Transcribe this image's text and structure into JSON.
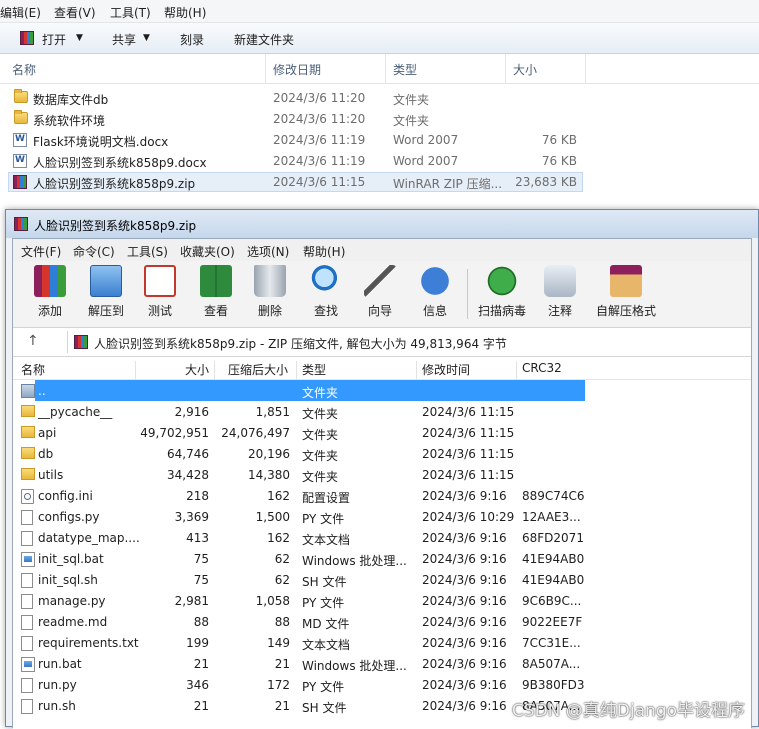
{
  "explorer": {
    "menu": [
      "编辑(E)",
      "查看(V)",
      "工具(T)",
      "帮助(H)"
    ],
    "toolbar": {
      "open": "打开",
      "share": "共享",
      "burn": "刻录",
      "new_folder": "新建文件夹"
    },
    "columns": {
      "name": "名称",
      "date": "修改日期",
      "type": "类型",
      "size": "大小"
    },
    "rows": [
      {
        "name": "数据库文件db",
        "date": "2024/3/6 11:20",
        "type": "文件夹",
        "size": ""
      },
      {
        "name": "系统软件环境",
        "date": "2024/3/6 11:20",
        "type": "文件夹",
        "size": ""
      },
      {
        "name": "Flask环境说明文档.docx",
        "date": "2024/3/6 11:19",
        "type": "Word 2007",
        "size": "76 KB"
      },
      {
        "name": "人脸识别签到系统k858p9.docx",
        "date": "2024/3/6 11:19",
        "type": "Word 2007",
        "size": "76 KB"
      },
      {
        "name": "人脸识别签到系统k858p9.zip",
        "date": "2024/3/6 11:15",
        "type": "WinRAR ZIP 压缩...",
        "size": "23,683 KB"
      }
    ]
  },
  "winrar": {
    "title": "人脸识别签到系统k858p9.zip",
    "menu": [
      "文件(F)",
      "命令(C)",
      "工具(S)",
      "收藏夹(O)",
      "选项(N)",
      "帮助(H)"
    ],
    "tools": [
      "添加",
      "解压到",
      "测试",
      "查看",
      "删除",
      "查找",
      "向导",
      "信息",
      "扫描病毒",
      "注释",
      "自解压格式"
    ],
    "up_arrow": "↑",
    "path": "人脸识别签到系统k858p9.zip - ZIP 压缩文件, 解包大小为 49,813,964 字节",
    "columns": {
      "name": "名称",
      "size": "大小",
      "packed": "压缩后大小",
      "type": "类型",
      "modified": "修改时间",
      "crc": "CRC32"
    },
    "rows": [
      {
        "name": "..",
        "size": "",
        "packed": "",
        "type": "文件夹",
        "modified": "",
        "crc": ""
      },
      {
        "name": "__pycache__",
        "size": "2,916",
        "packed": "1,851",
        "type": "文件夹",
        "modified": "2024/3/6 11:15",
        "crc": ""
      },
      {
        "name": "api",
        "size": "49,702,951",
        "packed": "24,076,497",
        "type": "文件夹",
        "modified": "2024/3/6 11:15",
        "crc": ""
      },
      {
        "name": "db",
        "size": "64,746",
        "packed": "20,196",
        "type": "文件夹",
        "modified": "2024/3/6 11:15",
        "crc": ""
      },
      {
        "name": "utils",
        "size": "34,428",
        "packed": "14,380",
        "type": "文件夹",
        "modified": "2024/3/6 11:15",
        "crc": ""
      },
      {
        "name": "config.ini",
        "size": "218",
        "packed": "162",
        "type": "配置设置",
        "modified": "2024/3/6 9:16",
        "crc": "889C74C6"
      },
      {
        "name": "configs.py",
        "size": "3,369",
        "packed": "1,500",
        "type": "PY 文件",
        "modified": "2024/3/6 10:29",
        "crc": "12AAE3..."
      },
      {
        "name": "datatype_map....",
        "size": "413",
        "packed": "162",
        "type": "文本文档",
        "modified": "2024/3/6 9:16",
        "crc": "68FD2071"
      },
      {
        "name": "init_sql.bat",
        "size": "75",
        "packed": "62",
        "type": "Windows 批处理...",
        "modified": "2024/3/6 9:16",
        "crc": "41E94AB0"
      },
      {
        "name": "init_sql.sh",
        "size": "75",
        "packed": "62",
        "type": "SH 文件",
        "modified": "2024/3/6 9:16",
        "crc": "41E94AB0"
      },
      {
        "name": "manage.py",
        "size": "2,981",
        "packed": "1,058",
        "type": "PY 文件",
        "modified": "2024/3/6 9:16",
        "crc": "9C6B9C..."
      },
      {
        "name": "readme.md",
        "size": "88",
        "packed": "88",
        "type": "MD 文件",
        "modified": "2024/3/6 9:16",
        "crc": "9022EE7F"
      },
      {
        "name": "requirements.txt",
        "size": "199",
        "packed": "149",
        "type": "文本文档",
        "modified": "2024/3/6 9:16",
        "crc": "7CC31E..."
      },
      {
        "name": "run.bat",
        "size": "21",
        "packed": "21",
        "type": "Windows 批处理...",
        "modified": "2024/3/6 9:16",
        "crc": "8A507A..."
      },
      {
        "name": "run.py",
        "size": "346",
        "packed": "172",
        "type": "PY 文件",
        "modified": "2024/3/6 9:16",
        "crc": "9B380FD3"
      },
      {
        "name": "run.sh",
        "size": "21",
        "packed": "21",
        "type": "SH 文件",
        "modified": "2024/3/6 9:16",
        "crc": "8A507A..."
      }
    ]
  },
  "watermark": "CSDN @真纯Django毕设程序"
}
